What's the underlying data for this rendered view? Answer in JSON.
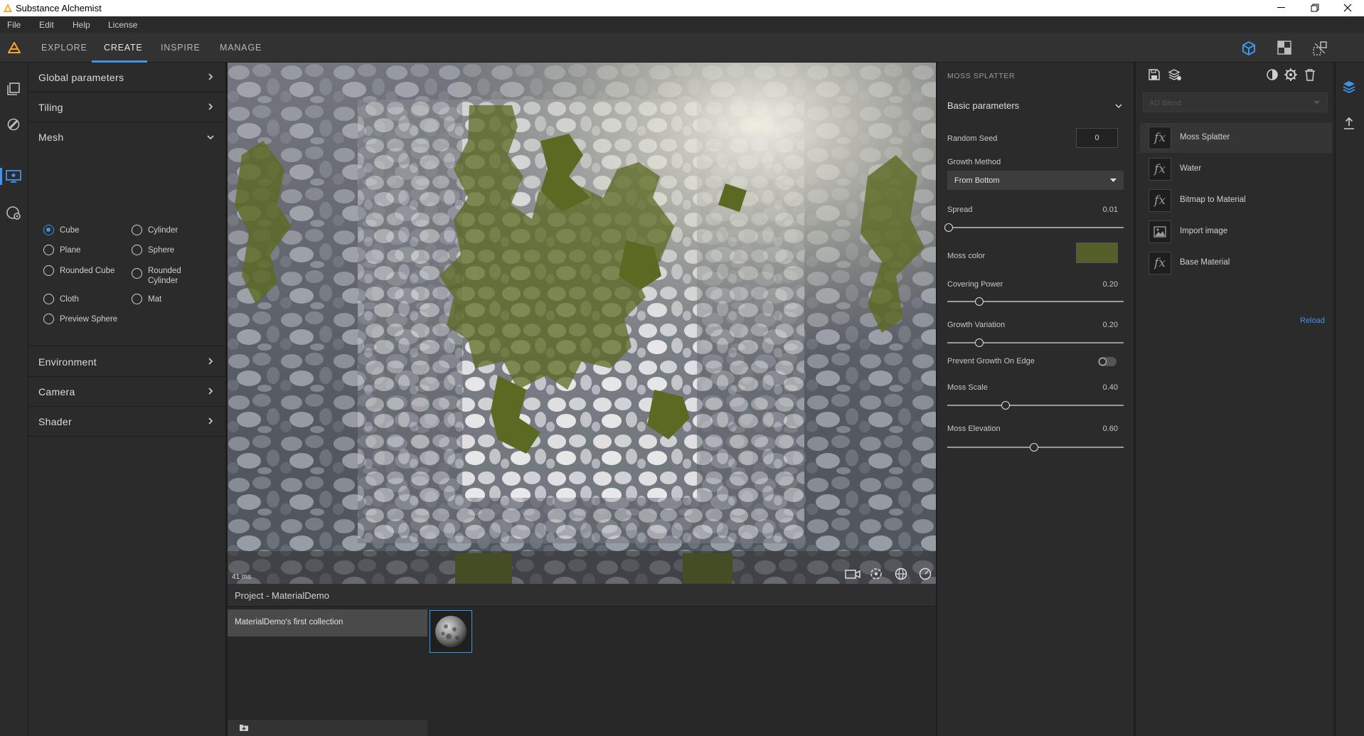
{
  "app": {
    "title": "Substance Alchemist"
  },
  "menu": [
    "File",
    "Edit",
    "Help",
    "License"
  ],
  "tabs": [
    "EXPLORE",
    "CREATE",
    "INSPIRE",
    "MANAGE"
  ],
  "active_tab": "CREATE",
  "left_panel": {
    "sections": {
      "global": "Global parameters",
      "tiling": "Tiling",
      "mesh": "Mesh",
      "environment": "Environment",
      "camera": "Camera",
      "shader": "Shader"
    },
    "mesh_options": {
      "cube": "Cube",
      "cylinder": "Cylinder",
      "plane": "Plane",
      "sphere": "Sphere",
      "rounded_cube": "Rounded Cube",
      "rounded_cylinder_1": "Rounded",
      "rounded_cylinder_2": "Cylinder",
      "cloth": "Cloth",
      "mat": "Mat",
      "preview_sphere": "Preview Sphere"
    },
    "selected_mesh": "Cube"
  },
  "viewport": {
    "frame_time": "41 ms"
  },
  "project": {
    "title": "Project - MaterialDemo",
    "collection": "MaterialDemo's first collection"
  },
  "params": {
    "filter_name": "MOSS SPLATTER",
    "group": "Basic parameters",
    "random_seed_label": "Random Seed",
    "random_seed": "0",
    "growth_method_label": "Growth Method",
    "growth_method": "From Bottom",
    "spread_label": "Spread",
    "spread": "0.01",
    "moss_color_label": "Moss color",
    "moss_color": "#545f2a",
    "covering_power_label": "Covering Power",
    "covering_power": "0.20",
    "growth_variation_label": "Growth Variation",
    "growth_variation": "0.20",
    "prevent_growth_label": "Prevent Growth On Edge",
    "prevent_growth": false,
    "moss_scale_label": "Moss Scale",
    "moss_scale": "0.40",
    "moss_elevation_label": "Moss Elevation",
    "moss_elevation": "0.60"
  },
  "stack": {
    "blend_placeholder": "AO Blend",
    "items": [
      "Moss Splatter",
      "Water",
      "Bitmap to Material",
      "Import image",
      "Base Material"
    ],
    "reload": "Reload"
  },
  "colors": {
    "accent": "#3f93e8",
    "panel": "#2b2b2b",
    "moss": "#5b6a22"
  }
}
